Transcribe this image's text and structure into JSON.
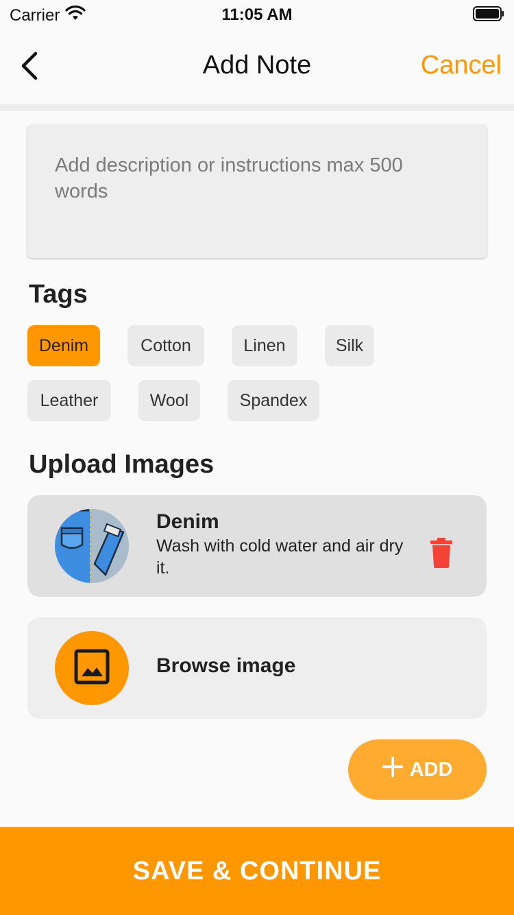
{
  "status_bar": {
    "carrier": "Carrier",
    "time": "11:05 AM"
  },
  "nav": {
    "title": "Add Note",
    "cancel_label": "Cancel"
  },
  "description": {
    "placeholder": "Add description or instructions max 500 words"
  },
  "tags": {
    "title": "Tags",
    "items": [
      {
        "label": "Denim",
        "selected": true
      },
      {
        "label": "Cotton",
        "selected": false
      },
      {
        "label": "Linen",
        "selected": false
      },
      {
        "label": "Silk",
        "selected": false
      },
      {
        "label": "Leather",
        "selected": false
      },
      {
        "label": "Wool",
        "selected": false
      },
      {
        "label": "Spandex",
        "selected": false
      }
    ]
  },
  "upload": {
    "title": "Upload Images",
    "items": [
      {
        "name": "Denim",
        "description": "Wash with cold water and air dry it."
      }
    ],
    "browse_label": "Browse image",
    "add_label": "ADD"
  },
  "footer": {
    "save_label": "SAVE & CONTINUE"
  },
  "colors": {
    "accent": "#ff9800",
    "delete": "#f44336"
  }
}
